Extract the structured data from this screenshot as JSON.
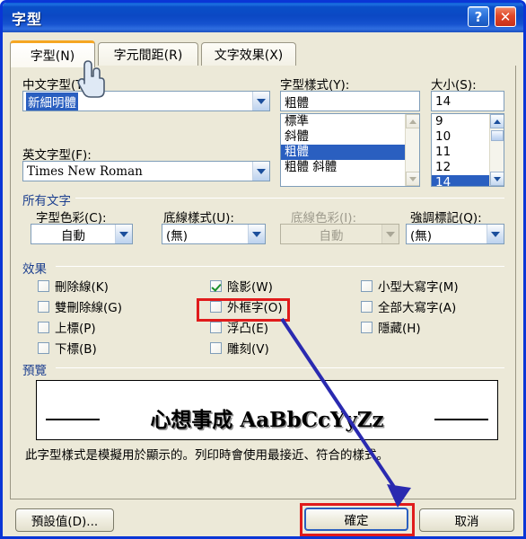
{
  "window": {
    "title": "字型",
    "help_button": "?",
    "close_button": "✕"
  },
  "tabs": [
    {
      "label": "字型(N)",
      "active": true
    },
    {
      "label": "字元間距(R)",
      "active": false
    },
    {
      "label": "文字效果(X)",
      "active": false
    }
  ],
  "font_section": {
    "chinese_font_label": "中文字型(T):",
    "chinese_font_value": "新細明體",
    "latin_font_label": "英文字型(F):",
    "latin_font_value": "Times New Roman",
    "style_label": "字型樣式(Y):",
    "style_value": "粗體",
    "style_options": [
      "標準",
      "斜體",
      "粗體",
      "粗體 斜體"
    ],
    "style_selected_index": 2,
    "size_label": "大小(S):",
    "size_value": "14",
    "size_options": [
      "9",
      "10",
      "11",
      "12",
      "14"
    ],
    "size_selected_index": 4
  },
  "all_text_section": {
    "group_label": "所有文字",
    "font_color_label": "字型色彩(C):",
    "font_color_value": "自動",
    "underline_style_label": "底線樣式(U):",
    "underline_style_value": "(無)",
    "underline_color_label": "底線色彩(I):",
    "underline_color_value": "自動",
    "underline_color_disabled": true,
    "emphasis_label": "強調標記(Q):",
    "emphasis_value": "(無)"
  },
  "effects_section": {
    "group_label": "效果",
    "column1": [
      {
        "label": "刪除線(K)",
        "checked": false
      },
      {
        "label": "雙刪除線(G)",
        "checked": false
      },
      {
        "label": "上標(P)",
        "checked": false
      },
      {
        "label": "下標(B)",
        "checked": false
      }
    ],
    "column2": [
      {
        "label": "陰影(W)",
        "checked": true
      },
      {
        "label": "外框字(O)",
        "checked": false
      },
      {
        "label": "浮凸(E)",
        "checked": false
      },
      {
        "label": "雕刻(V)",
        "checked": false
      }
    ],
    "column3": [
      {
        "label": "小型大寫字(M)",
        "checked": false
      },
      {
        "label": "全部大寫字(A)",
        "checked": false
      },
      {
        "label": "隱藏(H)",
        "checked": false
      }
    ]
  },
  "preview_section": {
    "group_label": "預覽",
    "sample_text": "心想事成 AaBbCcYyZz",
    "note": "此字型樣式是模擬用於顯示的。列印時會使用最接近、符合的樣式。"
  },
  "footer": {
    "default_button": "預設值(D)...",
    "ok_button": "確定",
    "cancel_button": "取消"
  },
  "annotations": {
    "highlight_color": "#e01b1b",
    "arrow_color": "#2a2ab0"
  }
}
